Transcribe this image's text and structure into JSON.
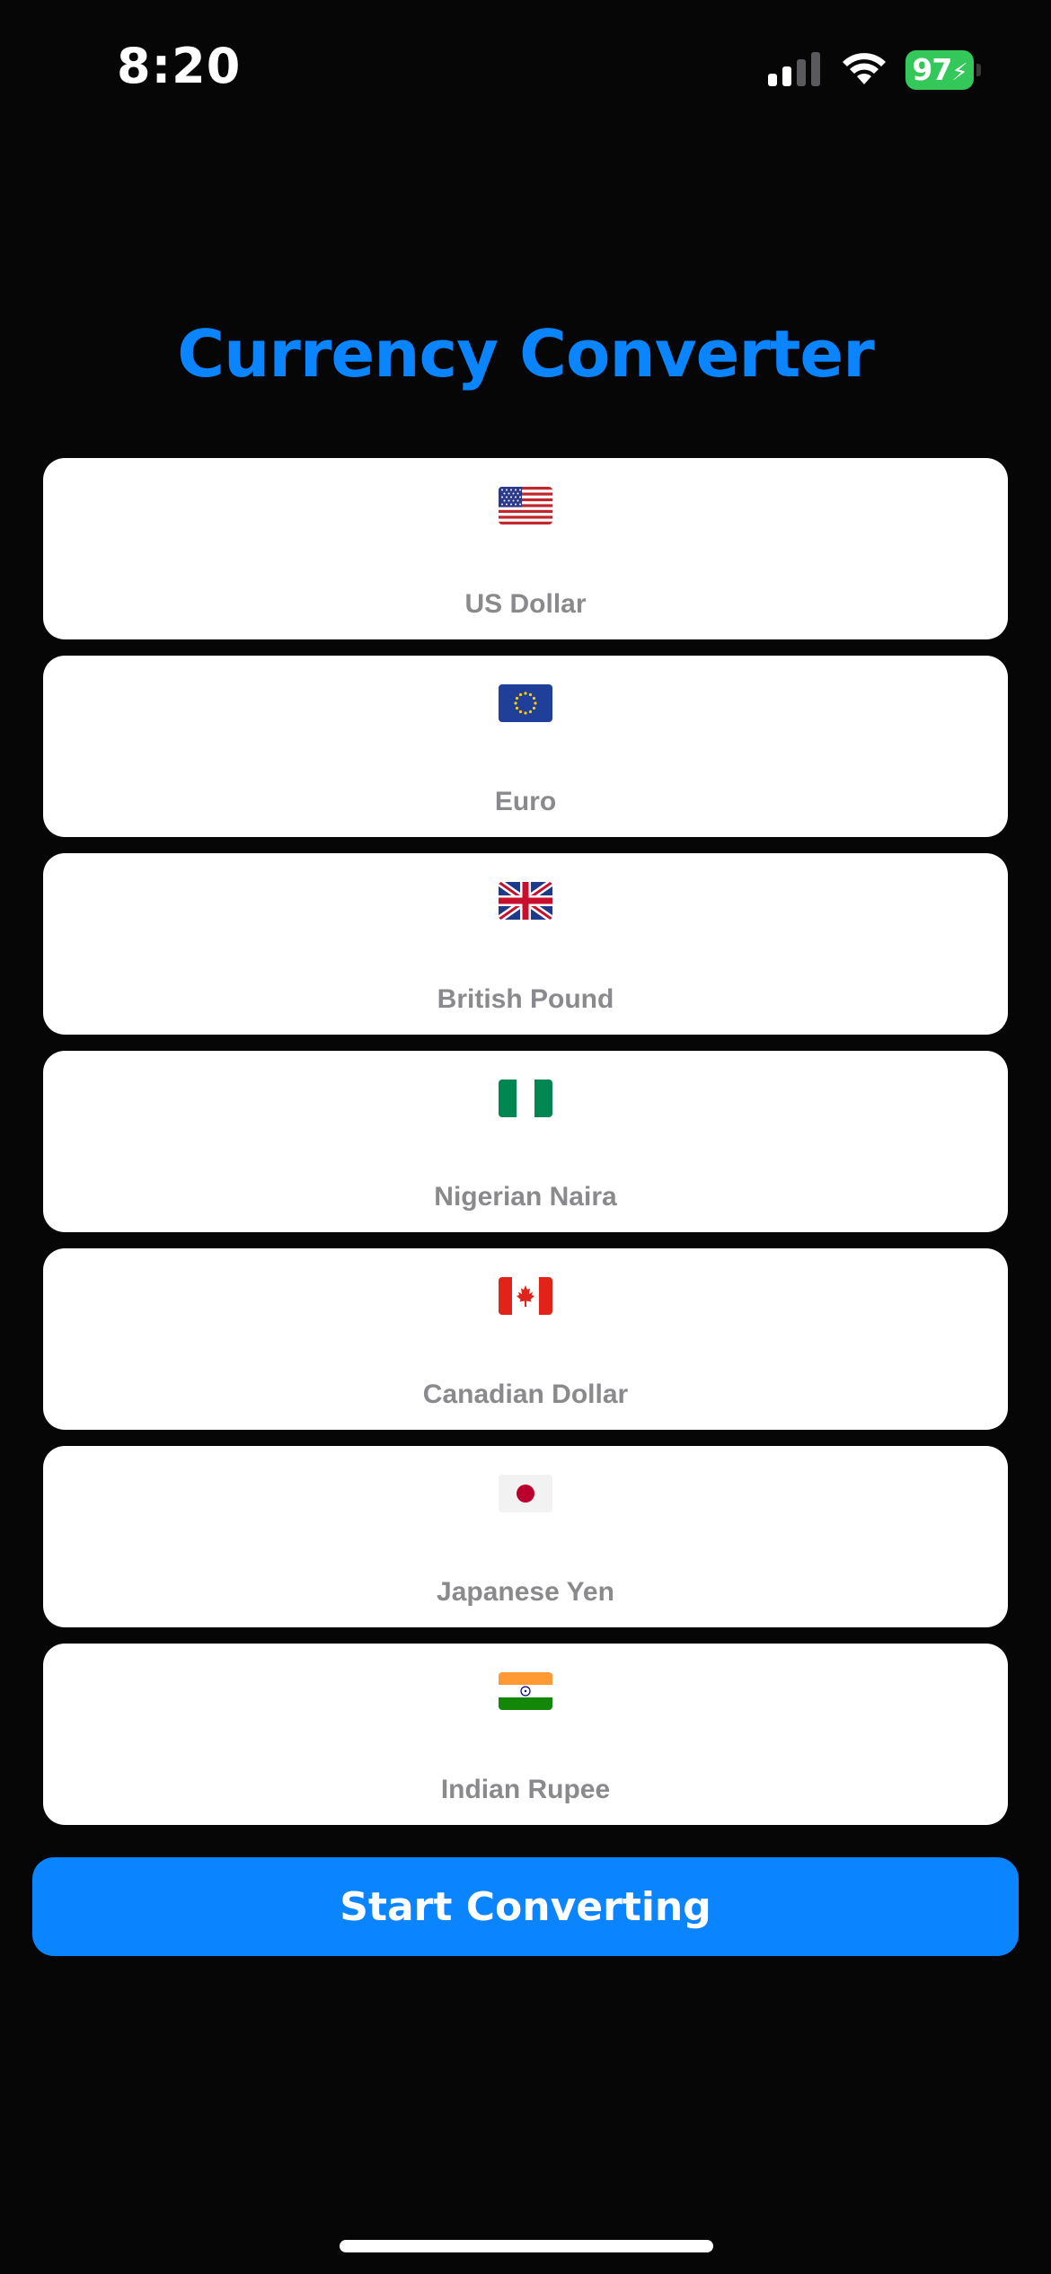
{
  "status_bar": {
    "time": "8:20",
    "battery_level": "97",
    "signal_icon": "cellular-signal-icon",
    "wifi_icon": "wifi-icon",
    "battery_icon": "battery-charging-icon"
  },
  "title": "Currency Converter",
  "currencies": [
    {
      "name": "US Dollar",
      "flag": "us-flag-icon"
    },
    {
      "name": "Euro",
      "flag": "eu-flag-icon"
    },
    {
      "name": "British Pound",
      "flag": "uk-flag-icon"
    },
    {
      "name": "Nigerian Naira",
      "flag": "nigeria-flag-icon"
    },
    {
      "name": "Canadian Dollar",
      "flag": "canada-flag-icon"
    },
    {
      "name": "Japanese Yen",
      "flag": "japan-flag-icon"
    },
    {
      "name": "Indian Rupee",
      "flag": "india-flag-icon"
    }
  ],
  "start_button": {
    "label": "Start Converting"
  },
  "colors": {
    "background": "#060606",
    "accent": "#0a84ff",
    "card": "#ffffff",
    "label_gray": "#8a8a8e",
    "battery_green": "#34c759"
  }
}
